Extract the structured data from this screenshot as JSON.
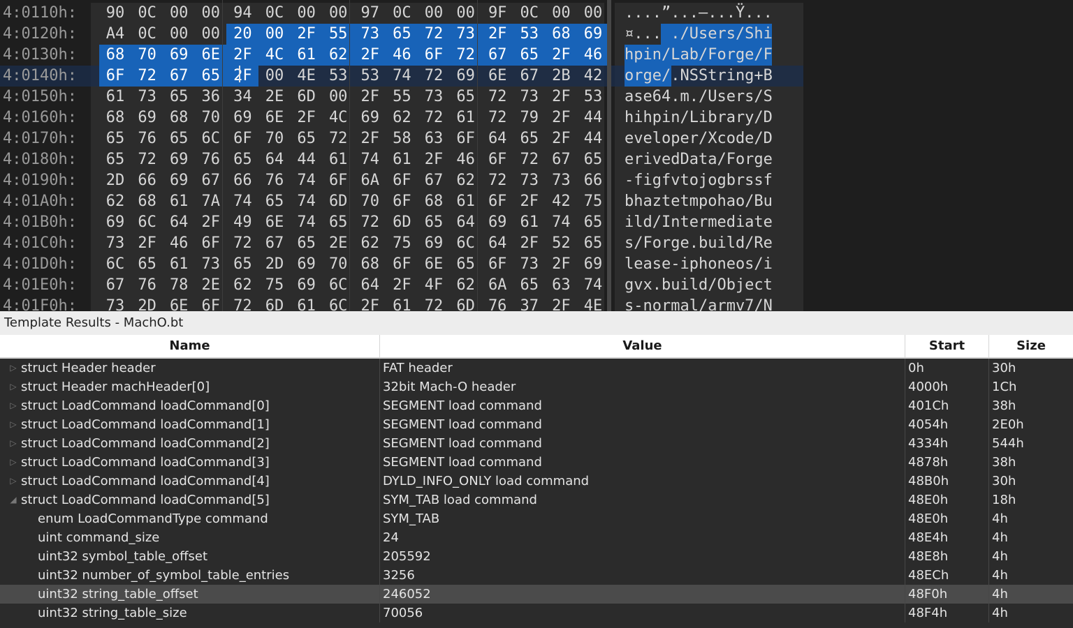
{
  "hex": {
    "rows": [
      {
        "addr": "4:0110h:",
        "bytes": [
          "90",
          "0C",
          "00",
          "00",
          "94",
          "0C",
          "00",
          "00",
          "97",
          "0C",
          "00",
          "00",
          "9F",
          "0C",
          "00",
          "00"
        ],
        "ascii": "....”...—...Ÿ..."
      },
      {
        "addr": "4:0120h:",
        "bytes": [
          "A4",
          "0C",
          "00",
          "00",
          "20",
          "00",
          "2F",
          "55",
          "73",
          "65",
          "72",
          "73",
          "2F",
          "53",
          "68",
          "69"
        ],
        "ascii": "¤... ./Users/Shi"
      },
      {
        "addr": "4:0130h:",
        "bytes": [
          "68",
          "70",
          "69",
          "6E",
          "2F",
          "4C",
          "61",
          "62",
          "2F",
          "46",
          "6F",
          "72",
          "67",
          "65",
          "2F",
          "46"
        ],
        "ascii": "hpin/Lab/Forge/F"
      },
      {
        "addr": "4:0140h:",
        "bytes": [
          "6F",
          "72",
          "67",
          "65",
          "2F",
          "00",
          "4E",
          "53",
          "53",
          "74",
          "72",
          "69",
          "6E",
          "67",
          "2B",
          "42"
        ],
        "ascii": "orge/.NSString+B"
      },
      {
        "addr": "4:0150h:",
        "bytes": [
          "61",
          "73",
          "65",
          "36",
          "34",
          "2E",
          "6D",
          "00",
          "2F",
          "55",
          "73",
          "65",
          "72",
          "73",
          "2F",
          "53"
        ],
        "ascii": "ase64.m./Users/S"
      },
      {
        "addr": "4:0160h:",
        "bytes": [
          "68",
          "69",
          "68",
          "70",
          "69",
          "6E",
          "2F",
          "4C",
          "69",
          "62",
          "72",
          "61",
          "72",
          "79",
          "2F",
          "44"
        ],
        "ascii": "hihpin/Library/D"
      },
      {
        "addr": "4:0170h:",
        "bytes": [
          "65",
          "76",
          "65",
          "6C",
          "6F",
          "70",
          "65",
          "72",
          "2F",
          "58",
          "63",
          "6F",
          "64",
          "65",
          "2F",
          "44"
        ],
        "ascii": "eveloper/Xcode/D"
      },
      {
        "addr": "4:0180h:",
        "bytes": [
          "65",
          "72",
          "69",
          "76",
          "65",
          "64",
          "44",
          "61",
          "74",
          "61",
          "2F",
          "46",
          "6F",
          "72",
          "67",
          "65"
        ],
        "ascii": "erivedData/Forge"
      },
      {
        "addr": "4:0190h:",
        "bytes": [
          "2D",
          "66",
          "69",
          "67",
          "66",
          "76",
          "74",
          "6F",
          "6A",
          "6F",
          "67",
          "62",
          "72",
          "73",
          "73",
          "66"
        ],
        "ascii": "-figfvtojogbrssf"
      },
      {
        "addr": "4:01A0h:",
        "bytes": [
          "62",
          "68",
          "61",
          "7A",
          "74",
          "65",
          "74",
          "6D",
          "70",
          "6F",
          "68",
          "61",
          "6F",
          "2F",
          "42",
          "75"
        ],
        "ascii": "bhaztetmpohao/Bu"
      },
      {
        "addr": "4:01B0h:",
        "bytes": [
          "69",
          "6C",
          "64",
          "2F",
          "49",
          "6E",
          "74",
          "65",
          "72",
          "6D",
          "65",
          "64",
          "69",
          "61",
          "74",
          "65"
        ],
        "ascii": "ild/Intermediate"
      },
      {
        "addr": "4:01C0h:",
        "bytes": [
          "73",
          "2F",
          "46",
          "6F",
          "72",
          "67",
          "65",
          "2E",
          "62",
          "75",
          "69",
          "6C",
          "64",
          "2F",
          "52",
          "65"
        ],
        "ascii": "s/Forge.build/Re"
      },
      {
        "addr": "4:01D0h:",
        "bytes": [
          "6C",
          "65",
          "61",
          "73",
          "65",
          "2D",
          "69",
          "70",
          "68",
          "6F",
          "6E",
          "65",
          "6F",
          "73",
          "2F",
          "69"
        ],
        "ascii": "lease-iphoneos/i"
      },
      {
        "addr": "4:01E0h:",
        "bytes": [
          "67",
          "76",
          "78",
          "2E",
          "62",
          "75",
          "69",
          "6C",
          "64",
          "2F",
          "4F",
          "62",
          "6A",
          "65",
          "63",
          "74"
        ],
        "ascii": "gvx.build/Object"
      },
      {
        "addr": "4:01F0h:",
        "bytes": [
          "73",
          "2D",
          "6E",
          "6F",
          "72",
          "6D",
          "61",
          "6C",
          "2F",
          "61",
          "72",
          "6D",
          "76",
          "37",
          "2F",
          "4E"
        ],
        "ascii": "s-normal/armv7/N"
      }
    ]
  },
  "template": {
    "title": "Template Results - MachO.bt",
    "columns": {
      "name": "Name",
      "value": "Value",
      "start": "Start",
      "size": "Size"
    },
    "rows": [
      {
        "name": "struct Header header",
        "value": "FAT header",
        "start": "0h",
        "size": "30h",
        "expander": "collapsed",
        "indent": 0
      },
      {
        "name": "struct Header machHeader[0]",
        "value": "32bit Mach-O header",
        "start": "4000h",
        "size": "1Ch",
        "expander": "collapsed",
        "indent": 0
      },
      {
        "name": "struct LoadCommand loadCommand[0]",
        "value": "SEGMENT load command",
        "start": "401Ch",
        "size": "38h",
        "expander": "collapsed",
        "indent": 0
      },
      {
        "name": "struct LoadCommand loadCommand[1]",
        "value": "SEGMENT load command",
        "start": "4054h",
        "size": "2E0h",
        "expander": "collapsed",
        "indent": 0
      },
      {
        "name": "struct LoadCommand loadCommand[2]",
        "value": "SEGMENT load command",
        "start": "4334h",
        "size": "544h",
        "expander": "collapsed",
        "indent": 0
      },
      {
        "name": "struct LoadCommand loadCommand[3]",
        "value": "SEGMENT load command",
        "start": "4878h",
        "size": "38h",
        "expander": "collapsed",
        "indent": 0
      },
      {
        "name": "struct LoadCommand loadCommand[4]",
        "value": "DYLD_INFO_ONLY load command",
        "start": "48B0h",
        "size": "30h",
        "expander": "collapsed",
        "indent": 0
      },
      {
        "name": "struct LoadCommand loadCommand[5]",
        "value": "SYM_TAB load command",
        "start": "48E0h",
        "size": "18h",
        "expander": "expanded",
        "indent": 0
      },
      {
        "name": "enum LoadCommandType command",
        "value": "SYM_TAB",
        "start": "48E0h",
        "size": "4h",
        "expander": "none",
        "indent": 1
      },
      {
        "name": "uint command_size",
        "value": "24",
        "start": "48E4h",
        "size": "4h",
        "expander": "none",
        "indent": 1
      },
      {
        "name": "uint32 symbol_table_offset",
        "value": "205592",
        "start": "48E8h",
        "size": "4h",
        "expander": "none",
        "indent": 1
      },
      {
        "name": "uint32 number_of_symbol_table_entries",
        "value": "3256",
        "start": "48ECh",
        "size": "4h",
        "expander": "none",
        "indent": 1
      },
      {
        "name": "uint32 string_table_offset",
        "value": "246052",
        "start": "48F0h",
        "size": "4h",
        "expander": "none",
        "indent": 1,
        "selected": true
      },
      {
        "name": "uint32 string_table_size",
        "value": "70056",
        "start": "48F4h",
        "size": "4h",
        "expander": "none",
        "indent": 1
      }
    ]
  }
}
